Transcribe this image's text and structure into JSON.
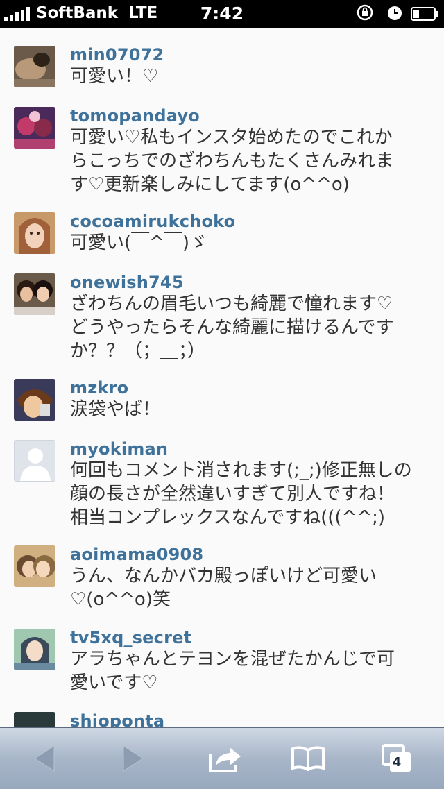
{
  "status_bar": {
    "carrier": "SoftBank",
    "network": "LTE",
    "time": "7:42"
  },
  "comments": [
    {
      "username": "min07072",
      "text": "可愛い！♡",
      "avatar": "photo-cat-icon"
    },
    {
      "username": "tomopandayo",
      "text": "可愛い♡私もインスタ始めたのでこれか\nらこっちでのざわちんもたくさんみれま\nす♡更新楽しみにしてます(o^^o)",
      "avatar": "photo-group-icon"
    },
    {
      "username": "cocoamirukchoko",
      "text": "可愛い(￣^￣)ゞ",
      "avatar": "photo-face-icon"
    },
    {
      "username": "onewish745",
      "text": "ざわちんの眉毛いつも綺麗で憧れます♡\nどうやったらそんな綺麗に描けるんです\nか？？（；＿；）",
      "avatar": "photo-pair-icon"
    },
    {
      "username": "mzkro",
      "text": "涙袋やば！",
      "avatar": "photo-anime-icon"
    },
    {
      "username": "myokiman",
      "text": "何回もコメント消されます(;_;)修正無しの\n顔の長さが全然違いすぎて別人ですね！\n相当コンプレックスなんですね(((^^;)",
      "avatar": "default-user-icon"
    },
    {
      "username": "aoimama0908",
      "text": "うん、なんかバカ殿っぽいけど可愛い\n♡(o^^o)笑",
      "avatar": "photo-closeup-icon"
    },
    {
      "username": "tv5xq_secret",
      "text": "アラちゃんとテヨンを混ぜたかんじで可\n愛いです♡",
      "avatar": "photo-girl-icon"
    },
    {
      "username": "shiopon­ta",
      "text": "",
      "avatar": "photo-dark-icon"
    }
  ],
  "toolbar": {
    "tabs_count": "4"
  }
}
